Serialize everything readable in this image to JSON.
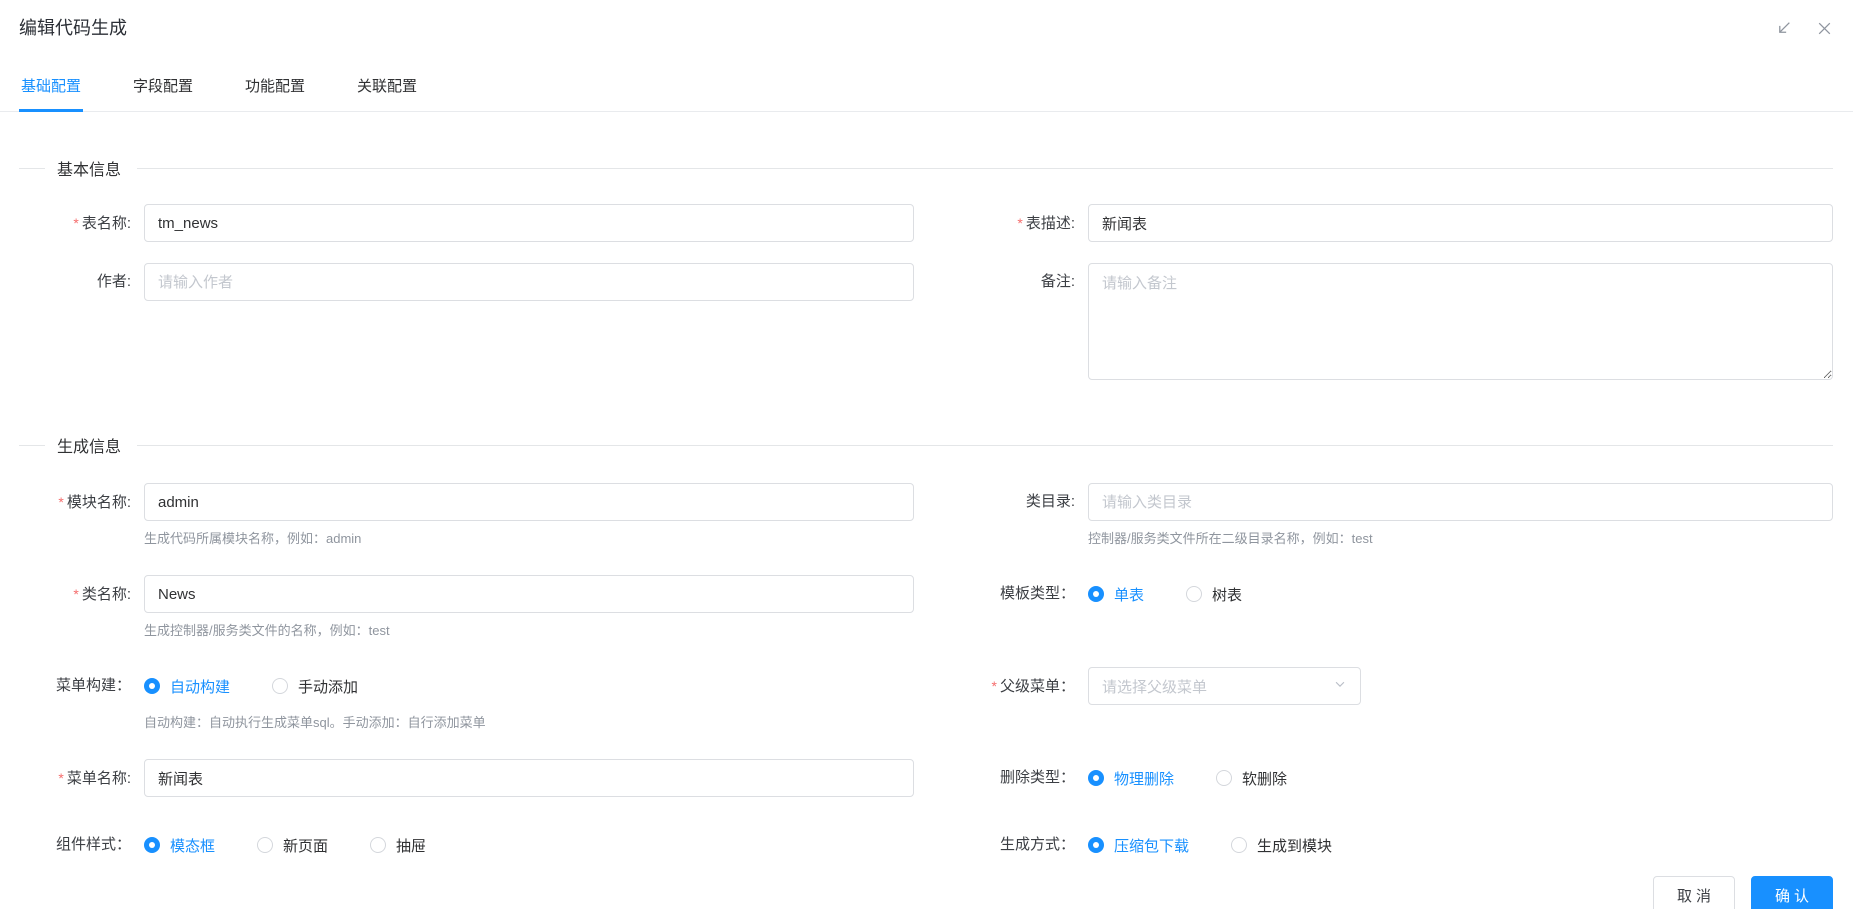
{
  "window": {
    "title": "编辑代码生成"
  },
  "icons": {
    "collapse_icon": "arrow-down-left",
    "close_icon": "x",
    "select_chevron_icon": "chevron-down"
  },
  "colors": {
    "accent": "#1890ff",
    "required": "#f56c6c"
  },
  "required_mark": "*",
  "tabs": [
    {
      "label": "基础配置",
      "active": true
    },
    {
      "label": "字段配置",
      "active": false
    },
    {
      "label": "功能配置",
      "active": false
    },
    {
      "label": "关联配置",
      "active": false
    }
  ],
  "sections": {
    "basic": {
      "title": "基本信息"
    },
    "generate": {
      "title": "生成信息"
    }
  },
  "form": {
    "table_name": {
      "label": "表名称:",
      "value": "tm_news"
    },
    "table_desc": {
      "label": "表描述:",
      "value": "新闻表"
    },
    "author": {
      "label": "作者:",
      "placeholder": "请输入作者"
    },
    "remark": {
      "label": "备注:",
      "placeholder": "请输入备注"
    },
    "module_name": {
      "label": "模块名称:",
      "value": "admin",
      "help": "生成代码所属模块名称，例如：admin"
    },
    "class_dir": {
      "label": "类目录:",
      "placeholder": "请输入类目录",
      "help": "控制器/服务类文件所在二级目录名称，例如：test"
    },
    "class_name": {
      "label": "类名称:",
      "value": "News",
      "help": "生成控制器/服务类文件的名称，例如：test"
    },
    "template_type": {
      "label": "模板类型：",
      "options": [
        "单表",
        "树表"
      ],
      "selected": 0
    },
    "menu_build": {
      "label": "菜单构建：",
      "options": [
        "自动构建",
        "手动添加"
      ],
      "selected": 0,
      "help": "自动构建：自动执行生成菜单sql。手动添加：自行添加菜单"
    },
    "parent_menu": {
      "label": "父级菜单：",
      "placeholder": "请选择父级菜单"
    },
    "menu_name": {
      "label": "菜单名称:",
      "value": "新闻表"
    },
    "delete_type": {
      "label": "删除类型：",
      "options": [
        "物理删除",
        "软删除"
      ],
      "selected": 0
    },
    "component_style": {
      "label": "组件样式：",
      "options": [
        "模态框",
        "新页面",
        "抽屉"
      ],
      "selected": 0
    },
    "generate_mode": {
      "label": "生成方式：",
      "options": [
        "压缩包下载",
        "生成到模块"
      ],
      "selected": 0
    }
  },
  "footer": {
    "cancel": "取消",
    "confirm": "确认"
  }
}
